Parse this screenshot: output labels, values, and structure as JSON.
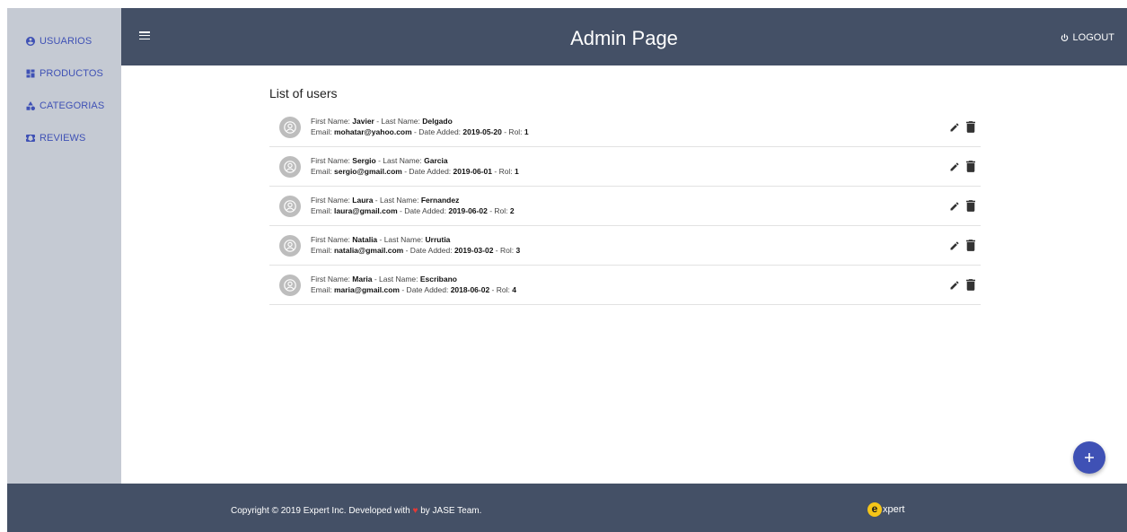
{
  "header": {
    "title": "Admin Page",
    "logout_label": "LOGOUT"
  },
  "sidebar": {
    "items": [
      {
        "label": "USUARIOS",
        "icon": "account-circle-icon"
      },
      {
        "label": "PRODUCTOS",
        "icon": "dashboard-icon"
      },
      {
        "label": "CATEGORIAS",
        "icon": "category-icon"
      },
      {
        "label": "REVIEWS",
        "icon": "ticket-icon"
      }
    ]
  },
  "main": {
    "list_title": "List of users",
    "labels": {
      "first_name": "First Name: ",
      "last_name": " - Last Name: ",
      "email": "Email: ",
      "date_added": " - Date Added: ",
      "rol": " - Rol: "
    },
    "users": [
      {
        "first_name": "Javier",
        "last_name": "Delgado",
        "email": "mohatar@yahoo.com",
        "date_added": "2019-05-20",
        "rol": "1"
      },
      {
        "first_name": "Sergio",
        "last_name": "Garcia",
        "email": "sergio@gmail.com",
        "date_added": "2019-06-01",
        "rol": "1"
      },
      {
        "first_name": "Laura",
        "last_name": "Fernandez",
        "email": "laura@gmail.com",
        "date_added": "2019-06-02",
        "rol": "2"
      },
      {
        "first_name": "Natalia",
        "last_name": "Urrutia",
        "email": "natalia@gmail.com",
        "date_added": "2019-03-02",
        "rol": "3"
      },
      {
        "first_name": "Maria",
        "last_name": "Escribano",
        "email": "maria@gmail.com",
        "date_added": "2018-06-02",
        "rol": "4"
      }
    ]
  },
  "fab": {
    "icon": "plus-icon"
  },
  "footer": {
    "copyright_before": "Copyright © 2019 Expert Inc. Developed with ",
    "heart": "♥",
    "copyright_after": " by JASE Team.",
    "brand_letter": "e",
    "brand_rest": "xpert"
  },
  "colors": {
    "header_bg": "#445066",
    "sidebar_bg": "#c5cad3",
    "accent": "#3f51b5"
  }
}
